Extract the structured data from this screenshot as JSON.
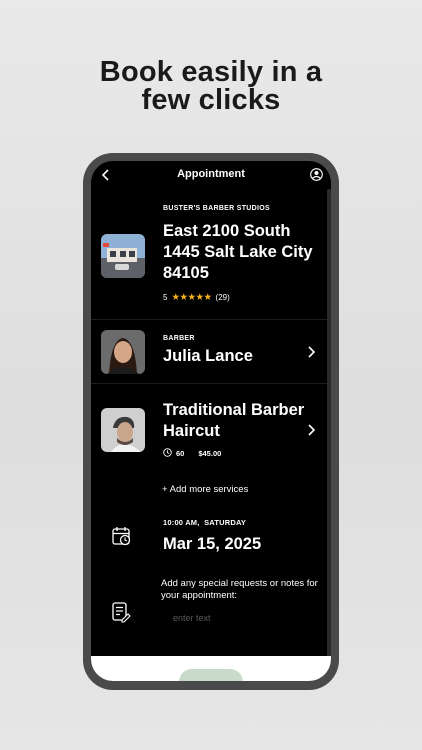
{
  "headline": {
    "line1": "Book easily in a",
    "line2": "few clicks"
  },
  "screen": {
    "title": "Appointment",
    "icons": {
      "back": "chevron-left-icon",
      "profile": "user-circle-icon"
    },
    "shop": {
      "label": "BUSTER'S BARBER STUDIOS",
      "address": "East 2100 South 1445 Salt Lake City 84105",
      "rating": "5",
      "stars": "★★★★★",
      "reviews": "(29)"
    },
    "barber": {
      "label": "BARBER",
      "name": "Julia Lance"
    },
    "service": {
      "name": "Traditional Barber Haircut",
      "duration": "60",
      "price": "$45.00"
    },
    "add_services": "+ Add more services",
    "datetime": {
      "label": "10:00 AM,  SATURDAY",
      "date": "Mar 15, 2025"
    },
    "notes": {
      "prompt": "Add any special requests or notes for your appointment:",
      "placeholder": "enter text",
      "value": ""
    }
  },
  "colors": {
    "star": "#f6b21b",
    "screen_bg": "#000000",
    "button": "#c9dac9"
  }
}
